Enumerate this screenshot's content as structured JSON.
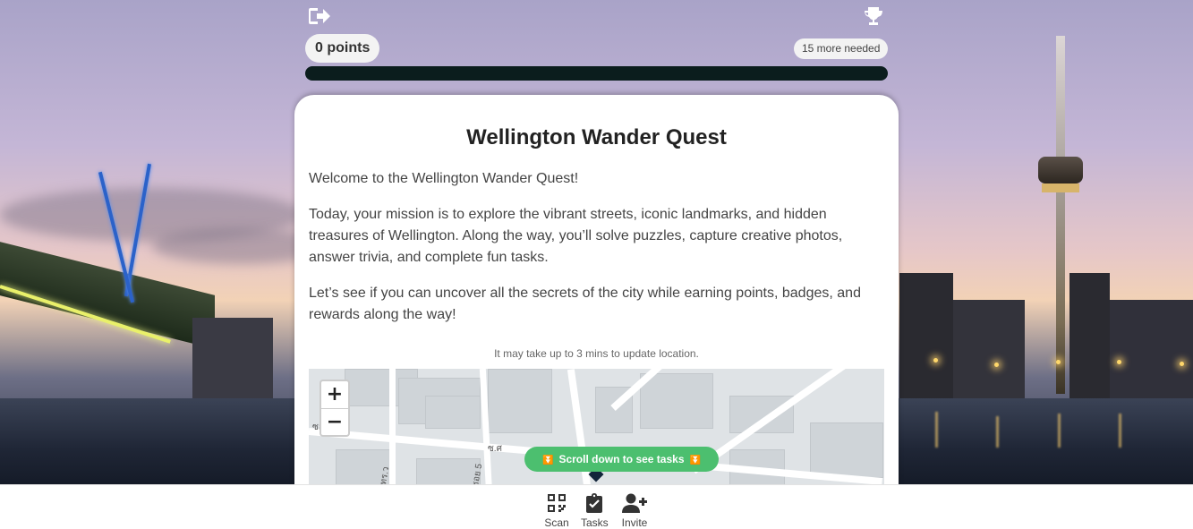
{
  "header": {
    "exit_icon": "sign-out-icon",
    "trophy_icon": "trophy-icon",
    "points": "0 points",
    "more_needed": "15 more needed",
    "progress": 0,
    "colors": {
      "progress_track": "#0b1d1d",
      "accent": "#4cbf6f"
    }
  },
  "quest": {
    "title": "Wellington Wander Quest",
    "paragraphs": [
      "Welcome to the Wellington Wander Quest!",
      "Today, your mission is to explore the vibrant streets, iconic landmarks, and hidden treasures of Wellington. Along the way, you’ll solve puzzles, capture creative photos, answer trivia, and complete fun tasks.",
      "Let’s see if you can uncover all the secrets of the city while earning points, badges, and rewards along the way!"
    ],
    "location_hint": "It may take up to 3 mins to update location."
  },
  "map": {
    "zoom_in": "+",
    "zoom_out": "−",
    "street_labels": [
      "ซอย",
      "ซ.ศ",
      "ทร.ว",
      "ซอย 5"
    ],
    "scroll_button": "Scroll down to see tasks"
  },
  "nav": {
    "items": [
      {
        "label": "Scan",
        "icon": "qr-code-icon"
      },
      {
        "label": "Tasks",
        "icon": "clipboard-check-icon"
      },
      {
        "label": "Invite",
        "icon": "user-plus-icon"
      }
    ]
  }
}
